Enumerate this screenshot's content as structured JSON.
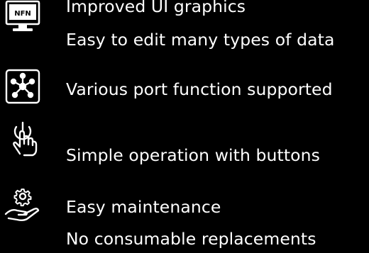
{
  "colors": {
    "background": "#000000",
    "text": "#ffffff",
    "icon": "#ffffff"
  },
  "features": [
    {
      "icon": "monitor-icon",
      "icon_screen_text": "NFN",
      "lines": [
        "Improved UI graphics",
        "Easy to edit many types of data"
      ]
    },
    {
      "icon": "network-hub-icon",
      "lines": [
        "Various port function supported"
      ]
    },
    {
      "icon": "touch-power-icon",
      "lines": [
        "Simple operation with buttons"
      ]
    },
    {
      "icon": "gear-hand-icon",
      "lines": [
        "Easy maintenance",
        "No consumable replacements"
      ]
    }
  ]
}
